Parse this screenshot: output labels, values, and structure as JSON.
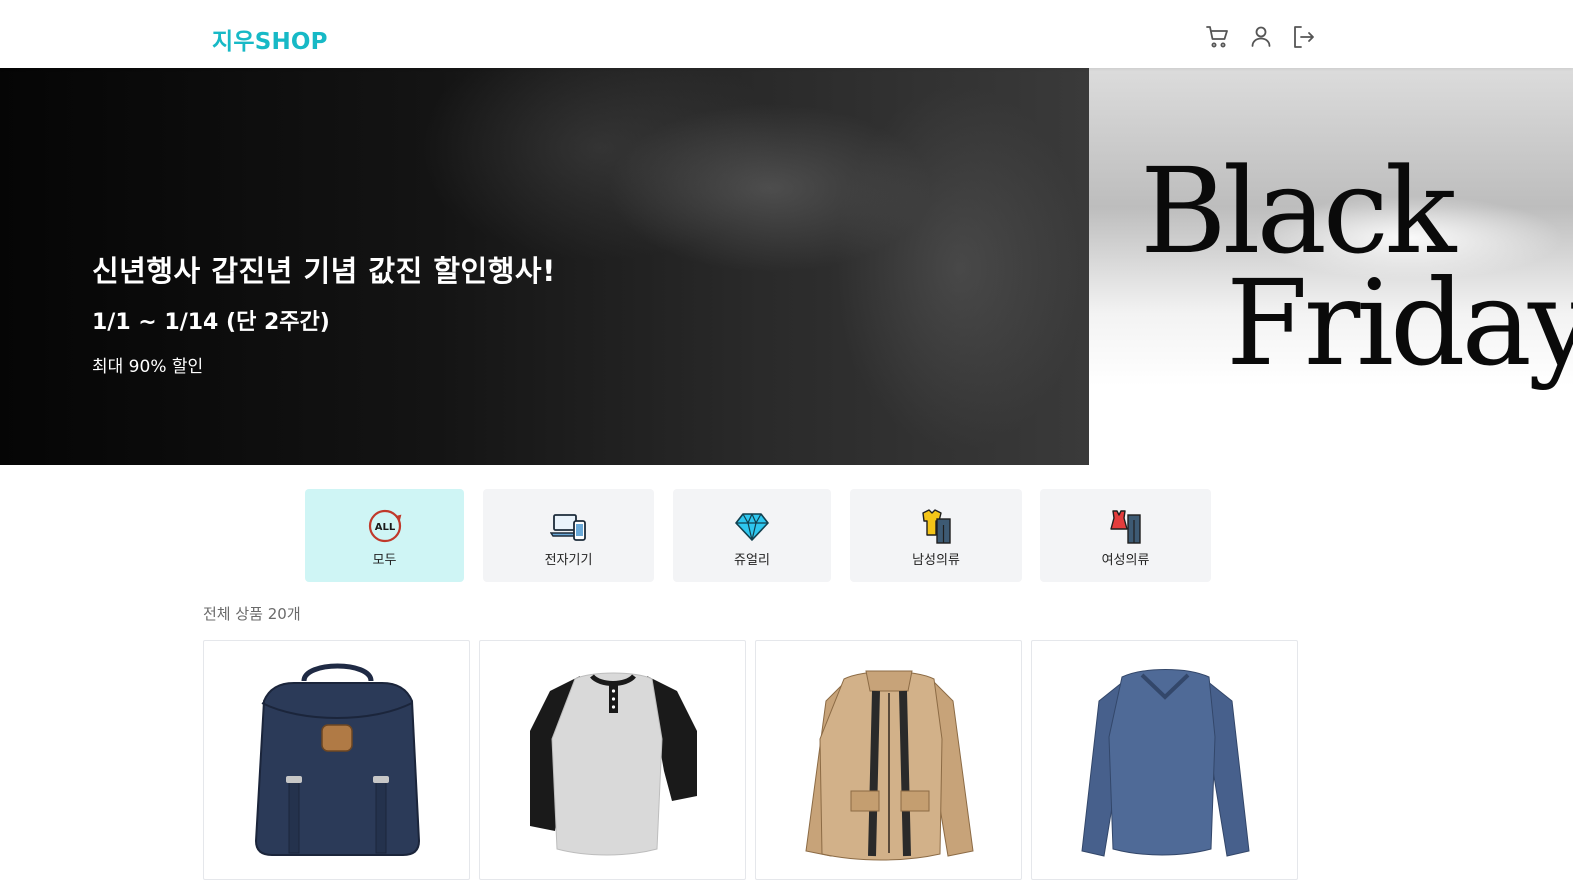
{
  "header": {
    "logo": "지우SHOP",
    "icons": [
      "cart-icon",
      "user-icon",
      "logout-icon"
    ]
  },
  "hero": {
    "title": "신년행사 갑진년 기념 값진 할인행사!",
    "date": "1/1 ~ 1/14 (단 2주간)",
    "subtitle": "최대 90% 할인",
    "side_text_line1": "Black",
    "side_text_line2": "Friday"
  },
  "categories": [
    {
      "label": "모두",
      "icon": "all-icon",
      "active": true
    },
    {
      "label": "전자기기",
      "icon": "devices-icon",
      "active": false
    },
    {
      "label": "쥬얼리",
      "icon": "diamond-icon",
      "active": false
    },
    {
      "label": "남성의류",
      "icon": "mens-clothing-icon",
      "active": false
    },
    {
      "label": "여성의류",
      "icon": "womens-clothing-icon",
      "active": false
    }
  ],
  "product_count_label": "전체 상품 20개",
  "products": [
    {
      "image": "backpack"
    },
    {
      "image": "raglan-henley-shirt"
    },
    {
      "image": "beige-jacket"
    },
    {
      "image": "blue-long-sleeve-tee"
    }
  ],
  "colors": {
    "brand": "#17b9c6",
    "active_category_bg": "#cff5f5",
    "category_bg": "#f3f4f6"
  }
}
